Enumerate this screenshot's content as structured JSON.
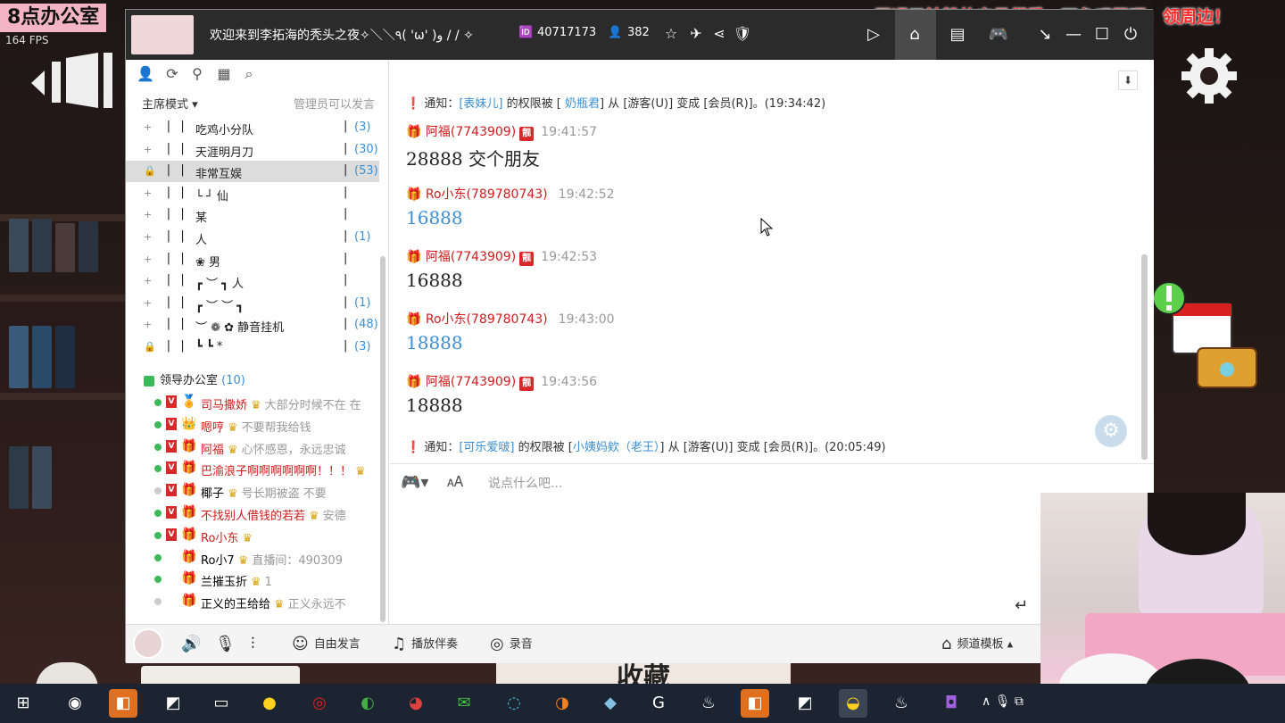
{
  "overlay": {
    "corner_label": "8点办公室",
    "fps": "164 FPS",
    "banner": "开通了钻粉的宝贝们看一下鱼吧置顶，领周边！",
    "collect": "收藏"
  },
  "titlebar": {
    "room_title": "欢迎来到李拓海的秃头之夜✧＼＼٩( 'ω' )و / / ✧",
    "room_id": "40717173",
    "members": "382",
    "icons": [
      "star-icon",
      "plane-icon",
      "share-icon",
      "report-icon"
    ],
    "right_icons": [
      "video-icon",
      "home-icon",
      "list-icon",
      "gamepad-icon",
      "minimize-to-tray-icon",
      "minimize-icon",
      "maximize-icon",
      "power-icon"
    ]
  },
  "left_panel": {
    "mode": "主席模式",
    "mode_note": "管理员可以发言",
    "channels": [
      {
        "name": "吃鸡小分队",
        "count": "(3)",
        "bar": "| |",
        "sep": "|",
        "lock": "+"
      },
      {
        "name": "天涯明月刀",
        "count": "(30)",
        "bar": "| |",
        "sep": "|",
        "lock": "+"
      },
      {
        "name": "非常互娱",
        "count": "(53)",
        "bar": "| |",
        "sep": "|",
        "lock": "🔒"
      },
      {
        "name": "└              ┘         仙",
        "count": "",
        "bar": "| |",
        "sep": "|",
        "lock": "+"
      },
      {
        "name": "                           某",
        "count": "",
        "bar": "| |",
        "sep": "|",
        "lock": "+"
      },
      {
        "name": "                           人",
        "count": "(1)",
        "bar": "| |",
        "sep": "|",
        "lock": "+"
      },
      {
        "name": "        ❀                  男",
        "count": "",
        "bar": "| |",
        "sep": "|",
        "lock": "+"
      },
      {
        "name": "    ┏ ︶ ┓                 人",
        "count": "",
        "bar": "| |",
        "sep": "|",
        "lock": "+"
      },
      {
        "name": "┏ ︶          ︶  ┓",
        "count": "(1)",
        "bar": "| |",
        "sep": "|",
        "lock": "+"
      },
      {
        "name": "︶  ❁   ✿  静音挂机",
        "count": "(48)",
        "bar": "| |",
        "sep": "|",
        "lock": "+"
      },
      {
        "name": "  ┗  ┗       *",
        "count": "(3)",
        "bar": "| |",
        "sep": "|",
        "lock": "🔒"
      }
    ],
    "group": {
      "name": "领导办公室",
      "count": "(10)"
    },
    "users": [
      {
        "name": "司马撒娇",
        "note": "大部分时候不在 在",
        "vip": "V",
        "red": true,
        "online": true
      },
      {
        "name": "嗯哼",
        "note": "不要帮我给钱",
        "vip": "V",
        "red": true,
        "online": true
      },
      {
        "name": "阿福",
        "note": "心怀感恩，永远忠诚",
        "vip": "V",
        "red": true,
        "online": true
      },
      {
        "name": "巴渝浪子啊啊啊啊啊啊！！！",
        "note": "",
        "vip": "V",
        "red": true,
        "online": true
      },
      {
        "name": "椰子",
        "note": "号长期被盗 不要",
        "vip": "V",
        "red": false,
        "online": false
      },
      {
        "name": "不找别人借钱的若若",
        "note": "安德",
        "vip": "V",
        "red": true,
        "online": true
      },
      {
        "name": "Ro小东",
        "note": "",
        "vip": "V",
        "red": true,
        "online": true
      },
      {
        "name": "Ro小7",
        "note": "直播间：490309",
        "vip": "",
        "red": false,
        "online": true
      },
      {
        "name": "兰摧玉折",
        "note": "1",
        "vip": "",
        "red": false,
        "online": true
      },
      {
        "name": "正义的王给给",
        "note": "正义永远不",
        "vip": "",
        "red": false,
        "online": false
      }
    ]
  },
  "chat": {
    "notice1": {
      "prefix": "通知：",
      "target": "[表妹儿]",
      "text1": " 的权限被 [ ",
      "actor": " 奶瓶君",
      "text2": "] 从 [游客(U)] 变成 [会员(R)]。(19:34:42)"
    },
    "messages": [
      {
        "user": "阿福(7743909)",
        "tag": "靓",
        "time": "19:41:57",
        "body": "28888  交个朋友",
        "blue": false
      },
      {
        "user": "Ro小东(789780743)",
        "tag": "",
        "time": "19:42:52",
        "body": "16888",
        "blue": true
      },
      {
        "user": "阿福(7743909)",
        "tag": "靓",
        "time": "19:42:53",
        "body": "16888",
        "blue": false
      },
      {
        "user": "Ro小东(789780743)",
        "tag": "",
        "time": "19:43:00",
        "body": "18888",
        "blue": true
      },
      {
        "user": "阿福(7743909)",
        "tag": "靓",
        "time": "19:43:56",
        "body": "18888",
        "blue": false
      }
    ],
    "notice2": {
      "prefix": "通知：",
      "target": "[可乐爱啵]",
      "text1": " 的权限被 [",
      "actor": "小姨妈欸（老王）",
      "text2": "] 从 [游客(U)] 变成 [会员(R)]。(20:05:49)"
    }
  },
  "input": {
    "placeholder": "说点什么吧..."
  },
  "bottombar": {
    "free_speak": "自由发言",
    "play_accomp": "播放伴奏",
    "record": "录音",
    "channel_template": "频道模板"
  },
  "taskbar": {
    "tray": "∧ 🎙 ⧉"
  },
  "colors": {
    "accent_red": "#d01c1c",
    "accent_blue": "#3b8fd6",
    "titlebar": "#2b2b2b",
    "taskbar": "#1b2430"
  }
}
